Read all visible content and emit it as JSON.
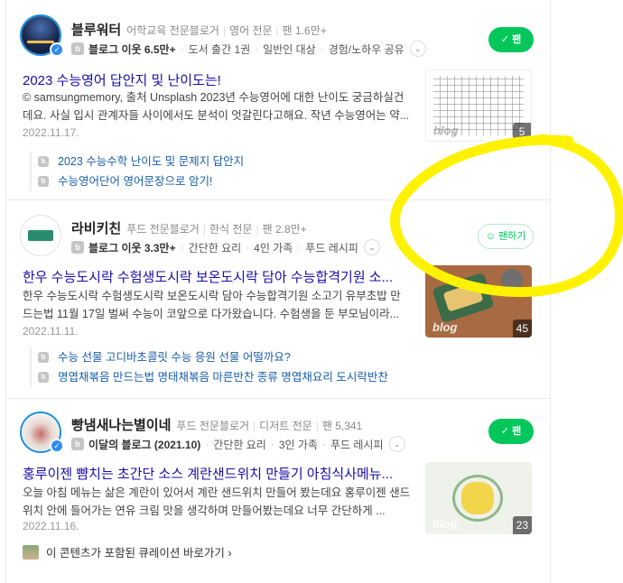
{
  "cards": [
    {
      "name": "블루워터",
      "tags": [
        "어학교육 전문블로거",
        "영어 전문",
        "팬 1.6만+"
      ],
      "meta": [
        "블로그 이웃 6.5만+",
        "도서 출간 1권",
        "일반인 대상",
        "경험/노하우 공유"
      ],
      "fan_label": "팬",
      "title": "2023 수능영어 답안지 및 난이도는!",
      "desc": "© samsungmemory, 출처 Unsplash 2023년 수능영어에 대한 난이도 궁금하실건데요. 사실 입시 관계자들 사이에서도 분석이 엇갈린다고해요. 작년 수능영어는 약...",
      "date": "2022.11.17.",
      "thumb_count": "5",
      "thumb_watermark": "blog",
      "sub_links": [
        "2023 수능수학 난이도 및 문제지 답안지",
        "수능영어단어 영어문장으로 암기!"
      ]
    },
    {
      "name": "라비키친",
      "tags": [
        "푸드 전문블로거",
        "한식 전문",
        "팬 2.8만+"
      ],
      "meta": [
        "블로그 이웃 3.3만+",
        "간단한 요리",
        "4인 가족",
        "푸드 레시피"
      ],
      "fan_label": "팬하기",
      "title": "한우 수능도시락 수험생도시락 보온도시락 담아 수능합격기원 소...",
      "desc": "한우 수능도시락 수험생도시락 보온도시락 담아 수능합격기원 소고기 유부초밥 만드는법 11월 17일 벌써 수능이 코앞으로 다가왔습니다. 수험생을 둔 부모님이라...",
      "date": "2022.11.11.",
      "thumb_count": "45",
      "thumb_watermark": "blog",
      "sub_links": [
        "수능 선물 고디바초콜릿 수능 응원 선물 어떨까요?",
        "명엽채볶음 만드는법 명태채볶음 마른반찬 종류 명엽채요리 도시락반찬"
      ]
    },
    {
      "name": "빵냄새나는별이네",
      "tags": [
        "푸드 전문블로거",
        "디저트 전문",
        "팬 5,341"
      ],
      "meta": [
        "이달의 블로그 (2021.10)",
        "간단한 요리",
        "3인 가족",
        "푸드 레시피"
      ],
      "fan_label": "팬",
      "title": "홍루이젠 뺨치는 초간단 소스 계란샌드위치 만들기 아침식사메뉴...",
      "desc": "오늘 아침 메뉴는 삶은 계란이 있어서 계란 샌드위치 만들어 봤는데요 홍루이젠 샌드위치 안에 들어가는 연유 크림 맛을 생각하며 만들어봤는데요 너무 간단하게 ...",
      "date": "2022.11.16.",
      "thumb_count": "23",
      "thumb_watermark": "blog",
      "curation": "이 콘텐츠가 포함된 큐레이션 바로가기 ›"
    }
  ],
  "colors": {
    "accent": "#03c75a",
    "link": "#1a0dab",
    "highlight": "#fff200"
  }
}
